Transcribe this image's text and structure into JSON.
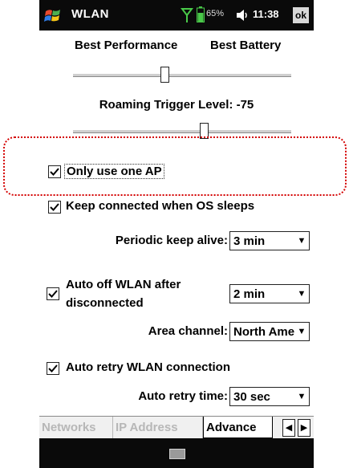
{
  "status_bar": {
    "title": "WLAN",
    "battery_text": "65%",
    "time": "11:38",
    "close_label": "ok"
  },
  "power_slider": {
    "left_label": "Best Performance",
    "right_label": "Best Battery",
    "level_fraction": 0.42
  },
  "roaming": {
    "label": "Roaming Trigger Level: -75",
    "level_fraction": 0.6
  },
  "options": {
    "only_one_ap": {
      "label": "Only use one AP",
      "checked": true
    },
    "keep_connected": {
      "label": "Keep connected when OS sleeps",
      "checked": true
    },
    "auto_off": {
      "label_line1": "Auto off WLAN after",
      "label_line2": "disconnected",
      "checked": true
    },
    "auto_retry": {
      "label": "Auto retry WLAN connection",
      "checked": true
    }
  },
  "fields": {
    "periodic_keep_alive": {
      "label": "Periodic keep alive:",
      "value": "3 min"
    },
    "auto_off_time": {
      "value": "2 min"
    },
    "area_channel": {
      "label": "Area channel:",
      "value": "North Ame"
    },
    "auto_retry_time": {
      "label": "Auto retry time:",
      "value": "30 sec"
    }
  },
  "tabs": [
    {
      "label": "Networks",
      "active": false
    },
    {
      "label": "IP Address",
      "active": false
    },
    {
      "label": "Advance",
      "active": true
    }
  ],
  "colors": {
    "status_bar_bg": "#0a0a0a",
    "highlight": "#d40000"
  },
  "icons": {
    "start": "windows-flag-icon",
    "signal": "signal-icon",
    "battery": "battery-icon",
    "volume": "speaker-icon",
    "keyboard": "keyboard-icon"
  }
}
